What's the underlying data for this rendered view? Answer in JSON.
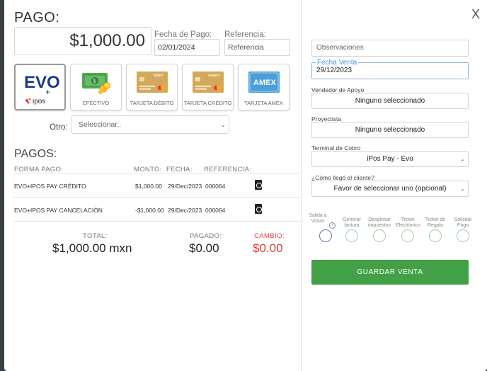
{
  "header": {
    "title": "PAGO:",
    "amount": "$1,000.00"
  },
  "fecha_pago": {
    "label": "Fecha de Pago:",
    "value": "02/01/2024"
  },
  "referencia": {
    "label": "Referencia:",
    "placeholder": "Referencia"
  },
  "payment_methods": [
    {
      "label": "",
      "icon": "evo-ipos-logo",
      "selected": true
    },
    {
      "label": "EFECTIVO",
      "icon": "cash-icon",
      "selected": false
    },
    {
      "label": "TARJETA DÉBITO",
      "icon": "debit-card-icon",
      "badge": "DEBIT",
      "selected": false
    },
    {
      "label": "TARJETA CRÉDITO",
      "icon": "credit-card-icon",
      "badge": "CREDIT",
      "selected": false
    },
    {
      "label": "TARJETA AMEX",
      "icon": "amex-card-icon",
      "badge": "AMEX",
      "selected": false
    }
  ],
  "evo_logo": {
    "text": "EVO",
    "sub": "ipos"
  },
  "otro": {
    "label": "Otro:",
    "value": "Seleccionar.."
  },
  "pagos": {
    "title": "PAGOS:",
    "columns": [
      "FORMA PAGO:",
      "MONTO:",
      "FECHA:",
      "REFERENCIA:"
    ],
    "rows": [
      {
        "forma": "EVO+IPOS PAY CRÉDITO",
        "monto": "$1,000.00",
        "fecha": "29/Dec/2023",
        "referencia": "000064"
      },
      {
        "forma": "EVO+IPOS PAY CANCELACIÓN",
        "monto": "-$1,000.00",
        "fecha": "29/Dec/2023",
        "referencia": "000064"
      }
    ]
  },
  "totals": {
    "total_label": "TOTAL:",
    "total_value": "$1,000.00 mxn",
    "pagado_label": "PAGADO:",
    "pagado_value": "$0.00",
    "cambio_label": "CAMBIO:",
    "cambio_value": "$0.00"
  },
  "right": {
    "close": "X",
    "observaciones_placeholder": "Observaciones",
    "fecha_venta_label": "Fecha Venta",
    "fecha_venta_value": "29/12/2023",
    "vendedor_label": "Vendedor de Apoyo",
    "vendedor_value": "Ninguno seleccionado",
    "proyectista_label": "Proyectista",
    "proyectista_value": "Ninguno seleccionado",
    "terminal_label": "Terminal de Cobro",
    "terminal_value": "iPos Pay - Evo",
    "como_label": "¿Cómo llegó el cliente?",
    "como_value": "Favor de seleccionar uno (opcional)",
    "options": [
      {
        "label": "Salida a Vistas",
        "info": "i"
      },
      {
        "label": "Generar factura"
      },
      {
        "label": "Desglosar impuestos"
      },
      {
        "label": "Ticket Electrónico"
      },
      {
        "label": "Ticket de Regalo"
      },
      {
        "label": "Solicitar Pago"
      }
    ],
    "save_label": "GUARDAR VENTA"
  },
  "colors": {
    "accent_green": "#43a047",
    "cambio_red": "#e53935",
    "focus_blue": "#4a90d9"
  }
}
